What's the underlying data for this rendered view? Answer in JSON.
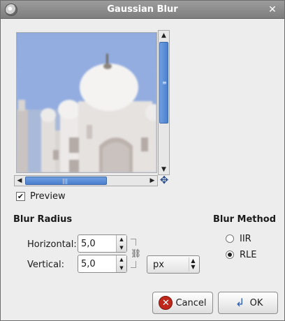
{
  "window": {
    "title": "Gaussian Blur"
  },
  "preview": {
    "checkbox_label": "Preview",
    "checked": true
  },
  "blur_radius": {
    "heading": "Blur Radius",
    "horizontal_label": "Horizontal:",
    "horizontal_value": "5,0",
    "vertical_label": "Vertical:",
    "vertical_value": "5,0",
    "unit": "px",
    "chain_linked": true
  },
  "blur_method": {
    "heading": "Blur Method",
    "options": [
      {
        "label": "IIR",
        "selected": false
      },
      {
        "label": "RLE",
        "selected": true
      }
    ]
  },
  "buttons": {
    "cancel_label": "Cancel",
    "ok_label": "OK"
  },
  "colors": {
    "scroll_thumb": "#4b7fcf",
    "cancel_icon": "#c0271b",
    "sky": "#8fa9db"
  }
}
